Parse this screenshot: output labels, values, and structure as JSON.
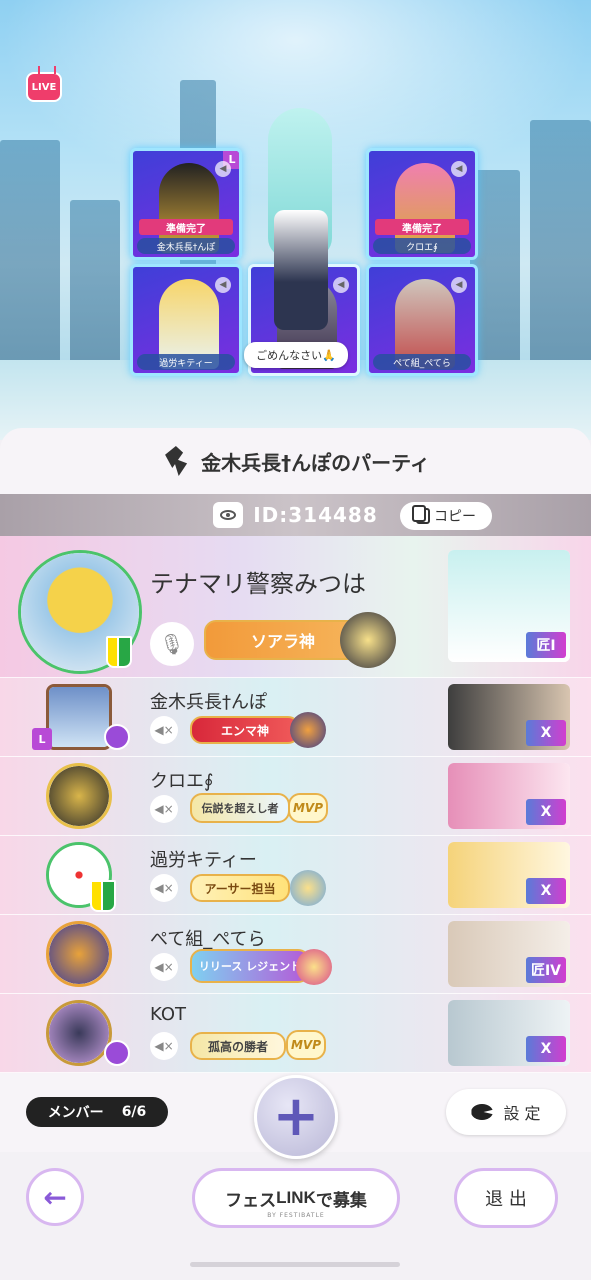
{
  "scene": {
    "live_label": "LIVE",
    "slots": [
      {
        "name": "金木兵長†んぽ",
        "status": "準備完了",
        "leader": "L"
      },
      {
        "name": "クロエ∮",
        "status": "準備完了"
      },
      {
        "name": "過労キティー"
      },
      {
        "name": "ぺて組_ぺてら"
      }
    ],
    "speech_bubble": "ごめんなさい🙏"
  },
  "party": {
    "title": "金木兵長†んぽのパーティ",
    "room_id": "ID:314488",
    "copy_label": "コピー"
  },
  "members": [
    {
      "name": "テナマリ警察みつは",
      "title": "ソアラ神",
      "rank": "匠I",
      "leader": false,
      "beginner": true,
      "colors": {
        "avatar": "#f5d24a",
        "card": "#a9e6ea"
      }
    },
    {
      "name": "金木兵長†んぽ",
      "title": "エンマ神",
      "rank": "X",
      "leader_label": "L",
      "beginner": false,
      "colors": {
        "avatar": "#6e90c8",
        "card": "#4a4a4a"
      }
    },
    {
      "name": "クロエ∮",
      "title": "伝説を超えし者",
      "badge": "MVP",
      "rank": "X",
      "beginner": false,
      "colors": {
        "avatar": "#d9b54a",
        "card": "#e68fb8"
      }
    },
    {
      "name": "過労キティー",
      "title": "アーサー担当",
      "rank": "X",
      "beginner": true,
      "colors": {
        "avatar": "#ffffff",
        "card": "#f5d37a"
      }
    },
    {
      "name": "ぺて組_ぺてら",
      "title": "リリース レジェンド",
      "rank": "匠IV",
      "beginner": false,
      "colors": {
        "avatar": "#e8a23a",
        "card": "#d9c9b8"
      }
    },
    {
      "name": "KOT",
      "title": "孤高の勝者",
      "badge": "MVP",
      "rank": "X",
      "beginner": false,
      "colors": {
        "avatar": "#3a3a5a",
        "card": "#b8c8d0"
      }
    }
  ],
  "controls": {
    "member_label": "メンバー",
    "member_count": "6/6",
    "add_symbol": "+",
    "settings_label": "設 定",
    "back_symbol": "←",
    "recruit_fest": "フェス",
    "recruit_link": "LINK",
    "recruit_suffix": "で募集",
    "recruit_by": "BY FESTIBATLE",
    "leave_label": "退 出"
  }
}
